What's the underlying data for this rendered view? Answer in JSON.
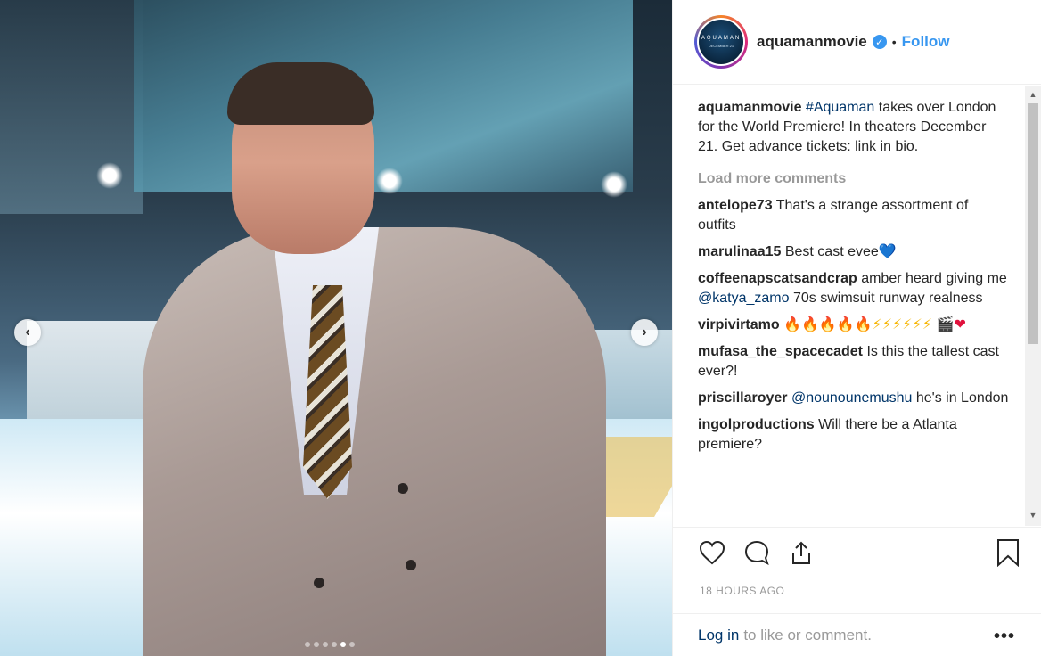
{
  "post": {
    "username": "aquamanmovie",
    "follow_label": "Follow",
    "separator": "•",
    "verified_glyph": "✓",
    "avatar_text": "AQUAMAN",
    "avatar_subtext": "DECEMBER 21",
    "caption_user": "aquamanmovie",
    "caption_hashtag": "#Aquaman",
    "caption_text": " takes over London for the World Premiere! In theaters December 21. Get advance tickets: link in bio.",
    "load_more": "Load more comments",
    "timestamp": "18 HOURS AGO",
    "login_link": "Log in",
    "login_text": "to like or comment.",
    "more_glyph": "•••"
  },
  "comments": [
    {
      "user": "antelope73",
      "text": "That's a strange assortment of outfits"
    },
    {
      "user": "marulinaa15",
      "text": "Best cast evee",
      "emoji": "💙"
    },
    {
      "user": "coffeenapscatsandcrap",
      "pre": "amber heard giving me ",
      "mention": "@katya_zamo",
      "text": " 70s swimsuit runway realness"
    },
    {
      "user": "virpivirtamo",
      "emoji_fire": "🔥🔥🔥🔥🔥",
      "emoji_bolt": "⚡⚡⚡⚡⚡⚡",
      "emoji_end": "🎬",
      "emoji_heart": "❤"
    },
    {
      "user": "mufasa_the_spacecadet",
      "text": "Is this the tallest cast ever?!"
    },
    {
      "user": "priscillaroyer",
      "mention": "@nounounemushu",
      "text": " he's in London"
    },
    {
      "user": "ingolproductions",
      "text": "Will there be a Atlanta premiere?"
    }
  ],
  "carousel": {
    "prev_glyph": "‹",
    "next_glyph": "›",
    "slide_count": 6,
    "active_index": 4
  },
  "icons": {
    "like": "heart-icon",
    "comment": "comment-icon",
    "share": "share-icon",
    "save": "bookmark-icon"
  },
  "colors": {
    "link": "#3897f0",
    "mention": "#003569",
    "muted": "#999999"
  }
}
